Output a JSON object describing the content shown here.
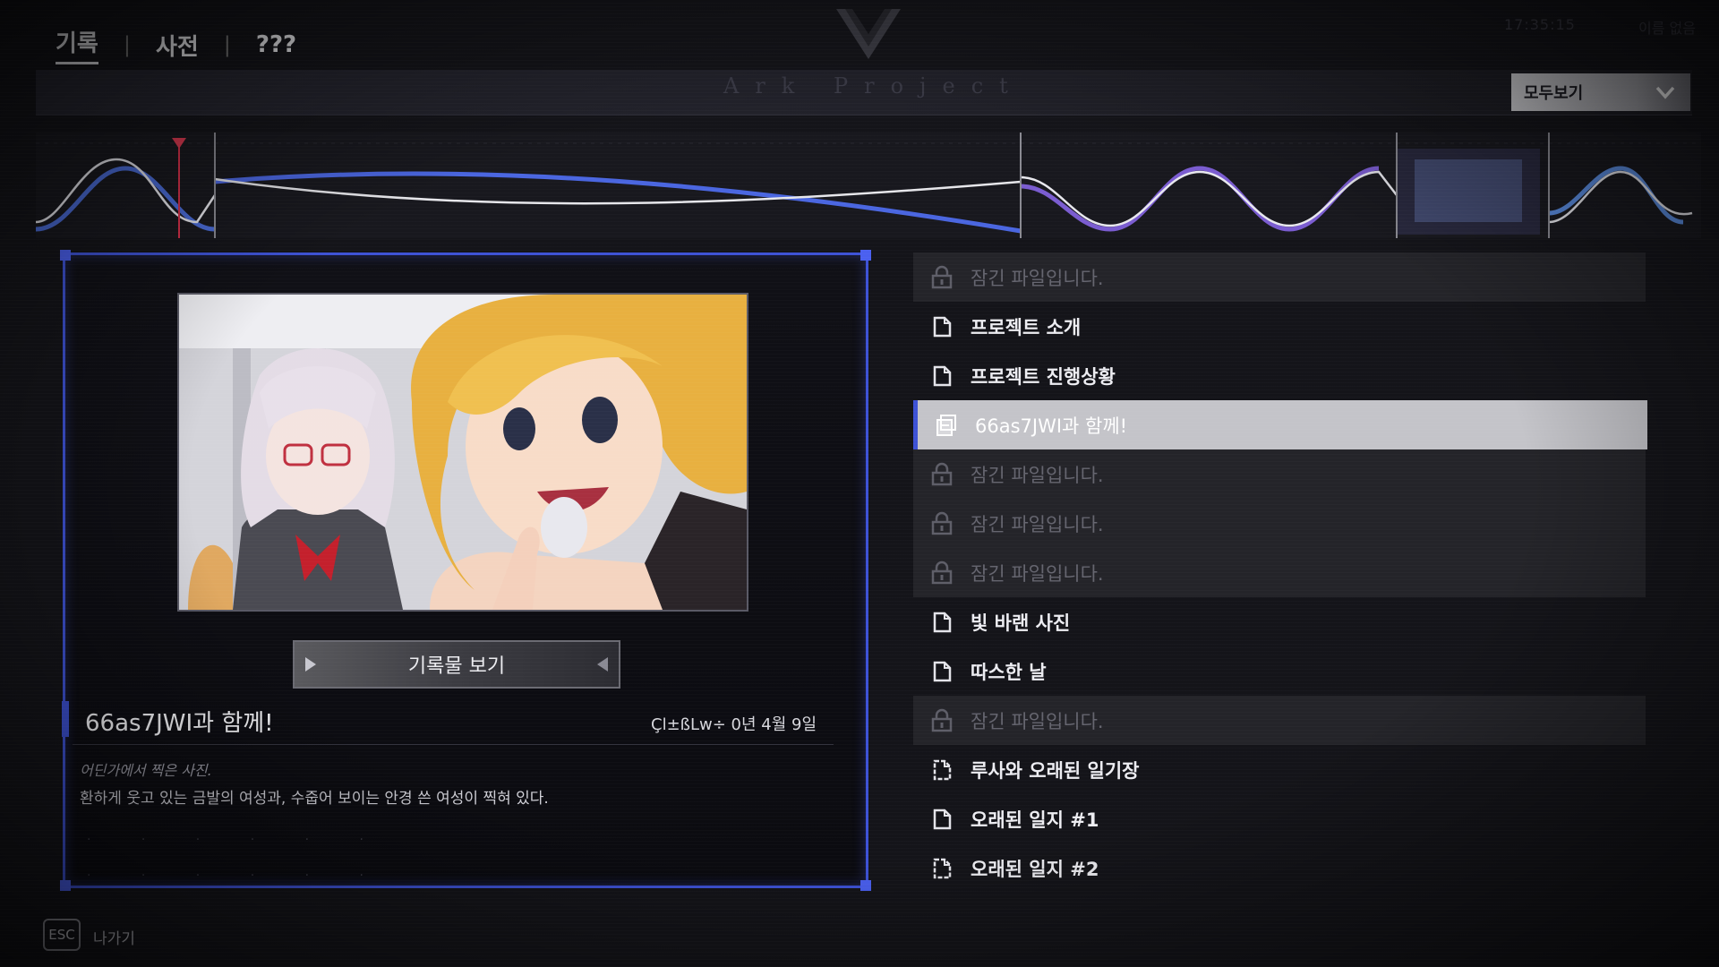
{
  "nav": {
    "tabs": [
      {
        "label": "기록"
      },
      {
        "label": "사전"
      },
      {
        "label": "???"
      }
    ],
    "separator": "|"
  },
  "header": {
    "clock": "17:35:15",
    "user": "이름 없음",
    "subtitle": "Ark Project",
    "filter_label": "모두보기"
  },
  "entry": {
    "view_button": "기록물 보기",
    "title": "66as7JWI과 함께!",
    "date": "Çl±ßLw÷ 0년 4월 9일",
    "description_line1": "어딘가에서 찍은 사진.",
    "description_line2": "환하게 웃고 있는 금발의 여성과, 수줍어 보이는 안경 쓴 여성이 찍혀 있다."
  },
  "files": [
    {
      "label": "잠긴 파일입니다.",
      "state": "locked",
      "icon": "lock-icon"
    },
    {
      "label": "프로젝트 소개",
      "state": "normal",
      "icon": "document-icon"
    },
    {
      "label": "프로젝트 진행상황",
      "state": "normal",
      "icon": "document-icon"
    },
    {
      "label": "66as7JWI과 함께!",
      "state": "selected",
      "icon": "image-file-icon"
    },
    {
      "label": "잠긴 파일입니다.",
      "state": "locked",
      "icon": "lock-icon"
    },
    {
      "label": "잠긴 파일입니다.",
      "state": "locked",
      "icon": "lock-icon"
    },
    {
      "label": "잠긴 파일입니다.",
      "state": "locked",
      "icon": "lock-icon"
    },
    {
      "label": "빛 바랜 사진",
      "state": "normal",
      "icon": "document-icon"
    },
    {
      "label": "따스한 날",
      "state": "normal",
      "icon": "document-icon"
    },
    {
      "label": "잠긴 파일입니다.",
      "state": "locked",
      "icon": "lock-icon"
    },
    {
      "label": "루사와 오래된 일기장",
      "state": "normal",
      "icon": "glitched-document-icon"
    },
    {
      "label": "오래된 일지 #1",
      "state": "normal",
      "icon": "document-icon"
    },
    {
      "label": "오래된 일지 #2",
      "state": "normal",
      "icon": "glitched-document-icon"
    }
  ],
  "footer": {
    "esc_key": "ESC",
    "exit_label": "나가기"
  },
  "colors": {
    "accent_blue": "#3d52d6",
    "selected_bg": "#c4c4c9",
    "locked_bg": "#242429",
    "background": "#141419"
  }
}
